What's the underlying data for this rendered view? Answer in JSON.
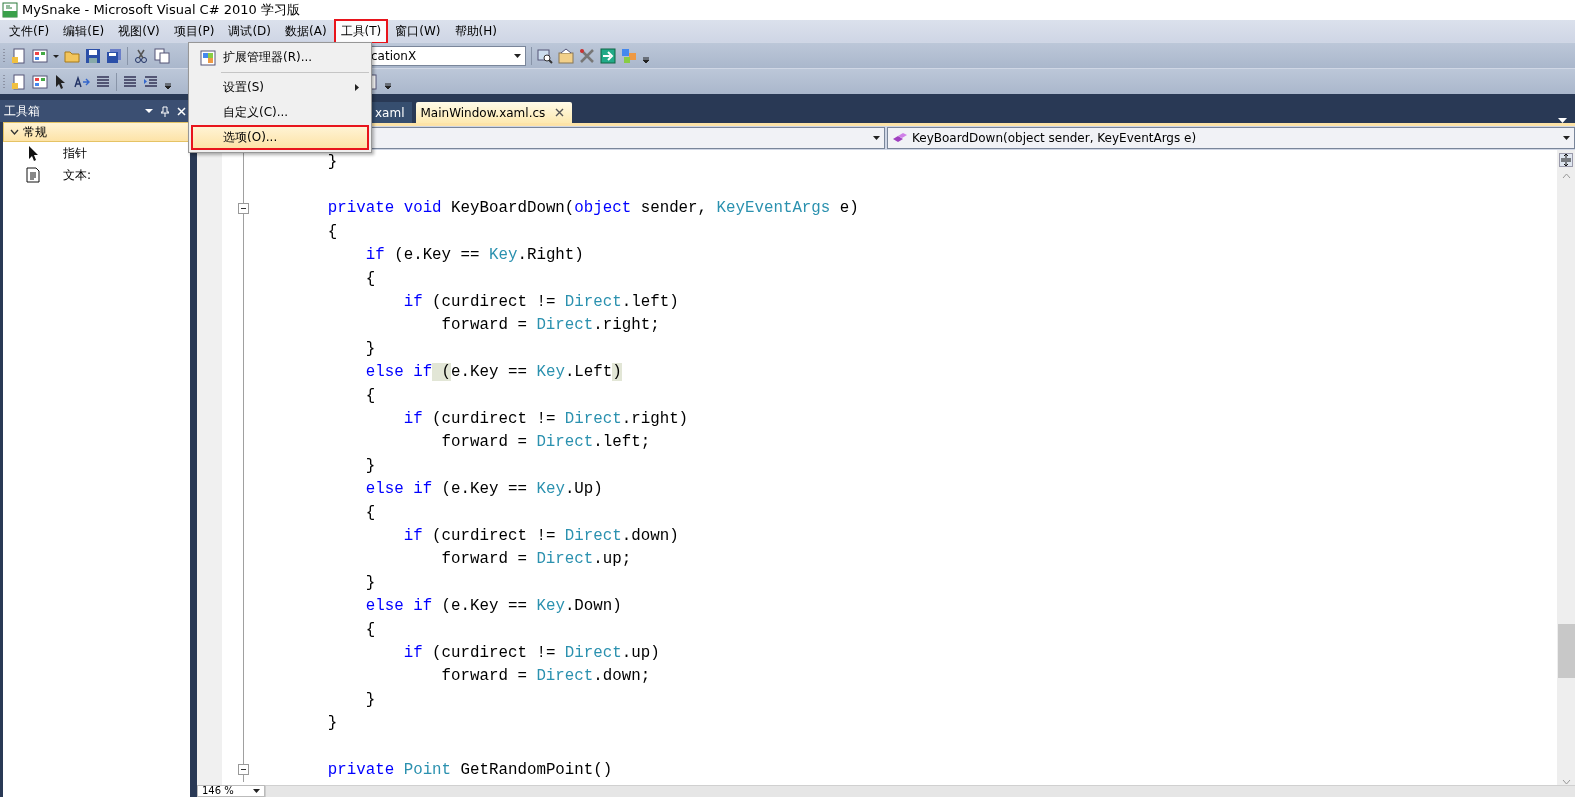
{
  "window": {
    "title": "MySnake - Microsoft Visual C# 2010 学习版"
  },
  "menu_bar": [
    {
      "label": "文件(F)",
      "selected": false,
      "highlighted": false
    },
    {
      "label": "编辑(E)",
      "selected": false,
      "highlighted": false
    },
    {
      "label": "视图(V)",
      "selected": false,
      "highlighted": false
    },
    {
      "label": "项目(P)",
      "selected": false,
      "highlighted": false
    },
    {
      "label": "调试(D)",
      "selected": false,
      "highlighted": false
    },
    {
      "label": "数据(A)",
      "selected": false,
      "highlighted": false
    },
    {
      "label": "工具(T)",
      "selected": true,
      "highlighted": true
    },
    {
      "label": "窗口(W)",
      "selected": false,
      "highlighted": false
    },
    {
      "label": "帮助(H)",
      "selected": false,
      "highlighted": false
    }
  ],
  "toolbar": {
    "combo_value": "cationX"
  },
  "tools_menu": [
    {
      "kind": "item",
      "label": "扩展管理器(R)...",
      "icon": true,
      "submenu": false,
      "selected": false,
      "highlighted": false
    },
    {
      "kind": "separator"
    },
    {
      "kind": "item",
      "label": "设置(S)",
      "icon": false,
      "submenu": true,
      "selected": false,
      "highlighted": false
    },
    {
      "kind": "item",
      "label": "自定义(C)...",
      "icon": false,
      "submenu": false,
      "selected": false,
      "highlighted": false
    },
    {
      "kind": "item",
      "label": "选项(O)...",
      "icon": false,
      "submenu": false,
      "selected": true,
      "highlighted": true
    }
  ],
  "toolbox": {
    "title": "工具箱",
    "group": {
      "label": "常规",
      "expanded": true
    },
    "items": [
      {
        "kind": "pointer",
        "label": "指针"
      },
      {
        "kind": "text",
        "label": "文本:"
      }
    ]
  },
  "tabs": [
    {
      "label": "xaml",
      "selected": false,
      "closable": false
    },
    {
      "label": "MainWindow.xaml.cs",
      "selected": true,
      "closable": true
    }
  ],
  "member_combo": {
    "value": "KeyBoardDown(object sender, KeyEventArgs e)"
  },
  "code_lines": [
    {
      "collapsible": false,
      "tokens": [
        {
          "text": "        }",
          "kind": "plain"
        }
      ]
    },
    {
      "collapsible": false
    },
    {
      "collapsible": true,
      "tokens": [
        {
          "text": "        private",
          "kind": "keyword"
        },
        {
          "text": " void",
          "kind": "keyword"
        },
        {
          "text": " KeyBoardDown(",
          "kind": "plain"
        },
        {
          "text": "object",
          "kind": "keyword"
        },
        {
          "text": " sender, ",
          "kind": "plain"
        },
        {
          "text": "KeyEventArgs",
          "kind": "type"
        },
        {
          "text": " e)",
          "kind": "plain"
        }
      ]
    },
    {
      "collapsible": false,
      "tokens": [
        {
          "text": "        {",
          "kind": "plain"
        }
      ]
    },
    {
      "collapsible": false,
      "tokens": [
        {
          "text": "            if",
          "kind": "keyword"
        },
        {
          "text": " (e.Key == ",
          "kind": "plain"
        },
        {
          "text": "Key",
          "kind": "type"
        },
        {
          "text": ".Right)",
          "kind": "plain"
        }
      ]
    },
    {
      "collapsible": false,
      "tokens": [
        {
          "text": "            {",
          "kind": "plain"
        }
      ]
    },
    {
      "collapsible": false,
      "tokens": [
        {
          "text": "                if",
          "kind": "keyword"
        },
        {
          "text": " (curdirect != ",
          "kind": "plain"
        },
        {
          "text": "Direct",
          "kind": "type"
        },
        {
          "text": ".left)",
          "kind": "plain"
        }
      ]
    },
    {
      "collapsible": false,
      "tokens": [
        {
          "text": "                    forward = ",
          "kind": "plain"
        },
        {
          "text": "Direct",
          "kind": "type"
        },
        {
          "text": ".right;",
          "kind": "plain"
        }
      ]
    },
    {
      "collapsible": false,
      "tokens": [
        {
          "text": "            }",
          "kind": "plain"
        }
      ]
    },
    {
      "collapsible": false,
      "tokens": [
        {
          "text": "            else",
          "kind": "keyword"
        },
        {
          "text": " if",
          "kind": "keyword"
        },
        {
          "text": " (",
          "kind": "match"
        },
        {
          "text": "e.Key == ",
          "kind": "plain"
        },
        {
          "text": "Key",
          "kind": "type"
        },
        {
          "text": ".Left",
          "kind": "plain"
        },
        {
          "text": ")",
          "kind": "match"
        }
      ]
    },
    {
      "collapsible": false,
      "tokens": [
        {
          "text": "            {",
          "kind": "plain"
        }
      ]
    },
    {
      "collapsible": false,
      "tokens": [
        {
          "text": "                if",
          "kind": "keyword"
        },
        {
          "text": " (curdirect != ",
          "kind": "plain"
        },
        {
          "text": "Direct",
          "kind": "type"
        },
        {
          "text": ".right)",
          "kind": "plain"
        }
      ]
    },
    {
      "collapsible": false,
      "tokens": [
        {
          "text": "                    forward = ",
          "kind": "plain"
        },
        {
          "text": "Direct",
          "kind": "type"
        },
        {
          "text": ".left;",
          "kind": "plain"
        }
      ]
    },
    {
      "collapsible": false,
      "tokens": [
        {
          "text": "            }",
          "kind": "plain"
        }
      ]
    },
    {
      "collapsible": false,
      "tokens": [
        {
          "text": "            else",
          "kind": "keyword"
        },
        {
          "text": " if",
          "kind": "keyword"
        },
        {
          "text": " (e.Key == ",
          "kind": "plain"
        },
        {
          "text": "Key",
          "kind": "type"
        },
        {
          "text": ".Up)",
          "kind": "plain"
        }
      ]
    },
    {
      "collapsible": false,
      "tokens": [
        {
          "text": "            {",
          "kind": "plain"
        }
      ]
    },
    {
      "collapsible": false,
      "tokens": [
        {
          "text": "                if",
          "kind": "keyword"
        },
        {
          "text": " (curdirect != ",
          "kind": "plain"
        },
        {
          "text": "Direct",
          "kind": "type"
        },
        {
          "text": ".down)",
          "kind": "plain"
        }
      ]
    },
    {
      "collapsible": false,
      "tokens": [
        {
          "text": "                    forward = ",
          "kind": "plain"
        },
        {
          "text": "Direct",
          "kind": "type"
        },
        {
          "text": ".up;",
          "kind": "plain"
        }
      ]
    },
    {
      "collapsible": false,
      "tokens": [
        {
          "text": "            }",
          "kind": "plain"
        }
      ]
    },
    {
      "collapsible": false,
      "tokens": [
        {
          "text": "            else",
          "kind": "keyword"
        },
        {
          "text": " if",
          "kind": "keyword"
        },
        {
          "text": " (e.Key == ",
          "kind": "plain"
        },
        {
          "text": "Key",
          "kind": "type"
        },
        {
          "text": ".Down)",
          "kind": "plain"
        }
      ]
    },
    {
      "collapsible": false,
      "tokens": [
        {
          "text": "            {",
          "kind": "plain"
        }
      ]
    },
    {
      "collapsible": false,
      "tokens": [
        {
          "text": "                if",
          "kind": "keyword"
        },
        {
          "text": " (curdirect != ",
          "kind": "plain"
        },
        {
          "text": "Direct",
          "kind": "type"
        },
        {
          "text": ".up)",
          "kind": "plain"
        }
      ]
    },
    {
      "collapsible": false,
      "tokens": [
        {
          "text": "                    forward = ",
          "kind": "plain"
        },
        {
          "text": "Direct",
          "kind": "type"
        },
        {
          "text": ".down;",
          "kind": "plain"
        }
      ]
    },
    {
      "collapsible": false,
      "tokens": [
        {
          "text": "            }",
          "kind": "plain"
        }
      ]
    },
    {
      "collapsible": false,
      "tokens": [
        {
          "text": "        }",
          "kind": "plain"
        }
      ]
    },
    {
      "collapsible": false
    },
    {
      "collapsible": true,
      "tokens": [
        {
          "text": "        private",
          "kind": "keyword"
        },
        {
          "text": " Point",
          "kind": "type"
        },
        {
          "text": " GetRandomPoint()",
          "kind": "plain"
        }
      ]
    }
  ],
  "zoom_combo": {
    "value": "146 %"
  }
}
